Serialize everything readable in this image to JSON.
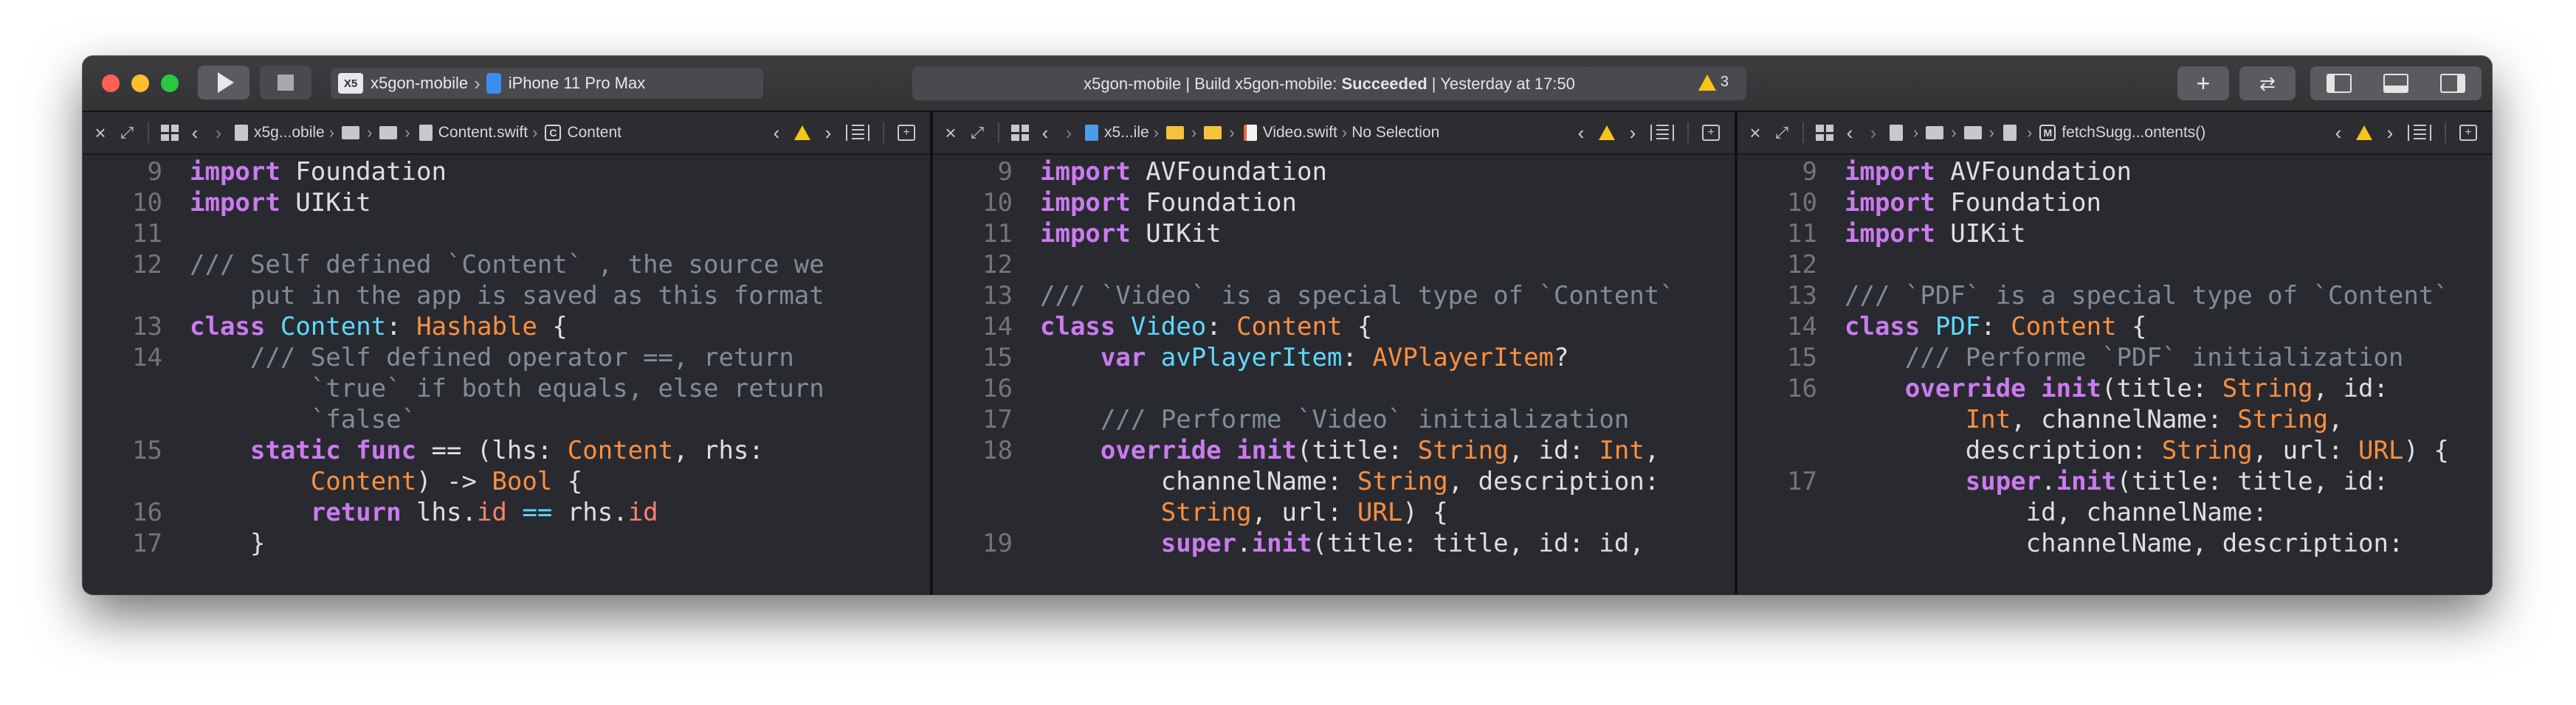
{
  "window": {
    "scheme_project": "x5gon-mobile",
    "scheme_project_icon": "X5",
    "scheme_device": "iPhone 11 Pro Max",
    "activity_prefix": "x5gon-mobile | Build x5gon-mobile: ",
    "activity_result": "Succeeded",
    "activity_suffix": " | Yesterday at 17:50",
    "warning_count": "3",
    "add_label": "+"
  },
  "editors": [
    {
      "breadcrumb_project": "x5g...obile",
      "file": "Content.swift",
      "symbol_badge": "C",
      "symbol": "Content",
      "lines": [
        {
          "n": "9",
          "tokens": [
            [
              "kw",
              "import"
            ],
            [
              "pl",
              " Foundation"
            ]
          ]
        },
        {
          "n": "10",
          "tokens": [
            [
              "kw",
              "import"
            ],
            [
              "pl",
              " UIKit"
            ]
          ]
        },
        {
          "n": "11",
          "tokens": []
        },
        {
          "n": "12",
          "tokens": [
            [
              "cm",
              "/// Self defined `Content` , the source we"
            ]
          ]
        },
        {
          "n": "",
          "tokens": [
            [
              "cm",
              "    put in the app is saved as this format"
            ]
          ]
        },
        {
          "n": "13",
          "tokens": [
            [
              "kw",
              "class"
            ],
            [
              "pl",
              " "
            ],
            [
              "ty",
              "Content"
            ],
            [
              "pl",
              ": "
            ],
            [
              "st",
              "Hashable"
            ],
            [
              "pl",
              " {"
            ]
          ]
        },
        {
          "n": "14",
          "tokens": [
            [
              "cm",
              "    /// Self defined operator ==, return"
            ]
          ]
        },
        {
          "n": "",
          "tokens": [
            [
              "cm",
              "        `true` if both equals, else return"
            ]
          ]
        },
        {
          "n": "",
          "tokens": [
            [
              "cm",
              "        `false`"
            ]
          ]
        },
        {
          "n": "15",
          "tokens": [
            [
              "kw",
              "    static func"
            ],
            [
              "pl",
              " == (lhs: "
            ],
            [
              "st",
              "Content"
            ],
            [
              "pl",
              ", rhs:"
            ]
          ]
        },
        {
          "n": "",
          "tokens": [
            [
              "st",
              "        Content"
            ],
            [
              "pl",
              ") -> "
            ],
            [
              "st",
              "Bool"
            ],
            [
              "pl",
              " {"
            ]
          ]
        },
        {
          "n": "16",
          "tokens": [
            [
              "kw",
              "        return"
            ],
            [
              "pl",
              " lhs."
            ],
            [
              "pr",
              "id"
            ],
            [
              "pl",
              " "
            ],
            [
              "ty",
              "=="
            ],
            [
              "pl",
              " rhs."
            ],
            [
              "pr",
              "id"
            ]
          ]
        },
        {
          "n": "17",
          "tokens": [
            [
              "pl",
              "    }"
            ]
          ]
        }
      ]
    },
    {
      "breadcrumb_project": "x5...ile",
      "file": "Video.swift",
      "symbol": "No Selection",
      "lines": [
        {
          "n": "9",
          "tokens": [
            [
              "kw",
              "import"
            ],
            [
              "pl",
              " AVFoundation"
            ]
          ]
        },
        {
          "n": "10",
          "tokens": [
            [
              "kw",
              "import"
            ],
            [
              "pl",
              " Foundation"
            ]
          ]
        },
        {
          "n": "11",
          "tokens": [
            [
              "kw",
              "import"
            ],
            [
              "pl",
              " UIKit"
            ]
          ]
        },
        {
          "n": "12",
          "tokens": []
        },
        {
          "n": "13",
          "tokens": [
            [
              "cm",
              "/// `Video` is a special type of `Content`"
            ]
          ]
        },
        {
          "n": "14",
          "tokens": [
            [
              "kw",
              "class"
            ],
            [
              "pl",
              " "
            ],
            [
              "ty",
              "Video"
            ],
            [
              "pl",
              ": "
            ],
            [
              "st",
              "Content"
            ],
            [
              "pl",
              " {"
            ]
          ]
        },
        {
          "n": "15",
          "tokens": [
            [
              "kw",
              "    var"
            ],
            [
              "pl",
              " "
            ],
            [
              "ty",
              "avPlayerItem"
            ],
            [
              "pl",
              ": "
            ],
            [
              "st",
              "AVPlayerItem"
            ],
            [
              "pl",
              "?"
            ]
          ]
        },
        {
          "n": "16",
          "tokens": []
        },
        {
          "n": "17",
          "tokens": [
            [
              "cm",
              "    /// Performe `Video` initialization"
            ]
          ]
        },
        {
          "n": "18",
          "tokens": [
            [
              "kw",
              "    override"
            ],
            [
              "pl",
              " "
            ],
            [
              "kw",
              "init"
            ],
            [
              "pl",
              "(title: "
            ],
            [
              "st",
              "String"
            ],
            [
              "pl",
              ", id: "
            ],
            [
              "st",
              "Int"
            ],
            [
              "pl",
              ","
            ]
          ]
        },
        {
          "n": "",
          "tokens": [
            [
              "pl",
              "        channelName: "
            ],
            [
              "st",
              "String"
            ],
            [
              "pl",
              ", description:"
            ]
          ]
        },
        {
          "n": "",
          "tokens": [
            [
              "st",
              "        String"
            ],
            [
              "pl",
              ", url: "
            ],
            [
              "st",
              "URL"
            ],
            [
              "pl",
              ") {"
            ]
          ]
        },
        {
          "n": "19",
          "tokens": [
            [
              "kw",
              "        super"
            ],
            [
              "pl",
              "."
            ],
            [
              "kw",
              "init"
            ],
            [
              "pl",
              "(title: title, id: id,"
            ]
          ]
        }
      ]
    },
    {
      "breadcrumb_project": "",
      "file": "",
      "symbol_badge": "M",
      "symbol": "fetchSugg...ontents()",
      "lines": [
        {
          "n": "9",
          "tokens": [
            [
              "kw",
              "import"
            ],
            [
              "pl",
              " AVFoundation"
            ]
          ]
        },
        {
          "n": "10",
          "tokens": [
            [
              "kw",
              "import"
            ],
            [
              "pl",
              " Foundation"
            ]
          ]
        },
        {
          "n": "11",
          "tokens": [
            [
              "kw",
              "import"
            ],
            [
              "pl",
              " UIKit"
            ]
          ]
        },
        {
          "n": "12",
          "tokens": []
        },
        {
          "n": "13",
          "tokens": [
            [
              "cm",
              "/// `PDF` is a special type of `Content`"
            ]
          ]
        },
        {
          "n": "14",
          "tokens": [
            [
              "kw",
              "class"
            ],
            [
              "pl",
              " "
            ],
            [
              "ty",
              "PDF"
            ],
            [
              "pl",
              ": "
            ],
            [
              "st",
              "Content"
            ],
            [
              "pl",
              " {"
            ]
          ]
        },
        {
          "n": "15",
          "tokens": [
            [
              "cm",
              "    /// Performe `PDF` initialization"
            ]
          ]
        },
        {
          "n": "16",
          "tokens": [
            [
              "kw",
              "    override"
            ],
            [
              "pl",
              " "
            ],
            [
              "kw",
              "init"
            ],
            [
              "pl",
              "(title: "
            ],
            [
              "st",
              "String"
            ],
            [
              "pl",
              ", id:"
            ]
          ]
        },
        {
          "n": "",
          "tokens": [
            [
              "st",
              "        Int"
            ],
            [
              "pl",
              ", channelName: "
            ],
            [
              "st",
              "String"
            ],
            [
              "pl",
              ","
            ]
          ]
        },
        {
          "n": "",
          "tokens": [
            [
              "pl",
              "        description: "
            ],
            [
              "st",
              "String"
            ],
            [
              "pl",
              ", url: "
            ],
            [
              "st",
              "URL"
            ],
            [
              "pl",
              ") {"
            ]
          ]
        },
        {
          "n": "17",
          "tokens": [
            [
              "kw",
              "        super"
            ],
            [
              "pl",
              "."
            ],
            [
              "kw",
              "init"
            ],
            [
              "pl",
              "(title: title, id:"
            ]
          ]
        },
        {
          "n": "",
          "tokens": [
            [
              "pl",
              "            id, channelName:"
            ]
          ]
        },
        {
          "n": "",
          "tokens": [
            [
              "pl",
              "            channelName, description:"
            ]
          ]
        }
      ]
    }
  ]
}
